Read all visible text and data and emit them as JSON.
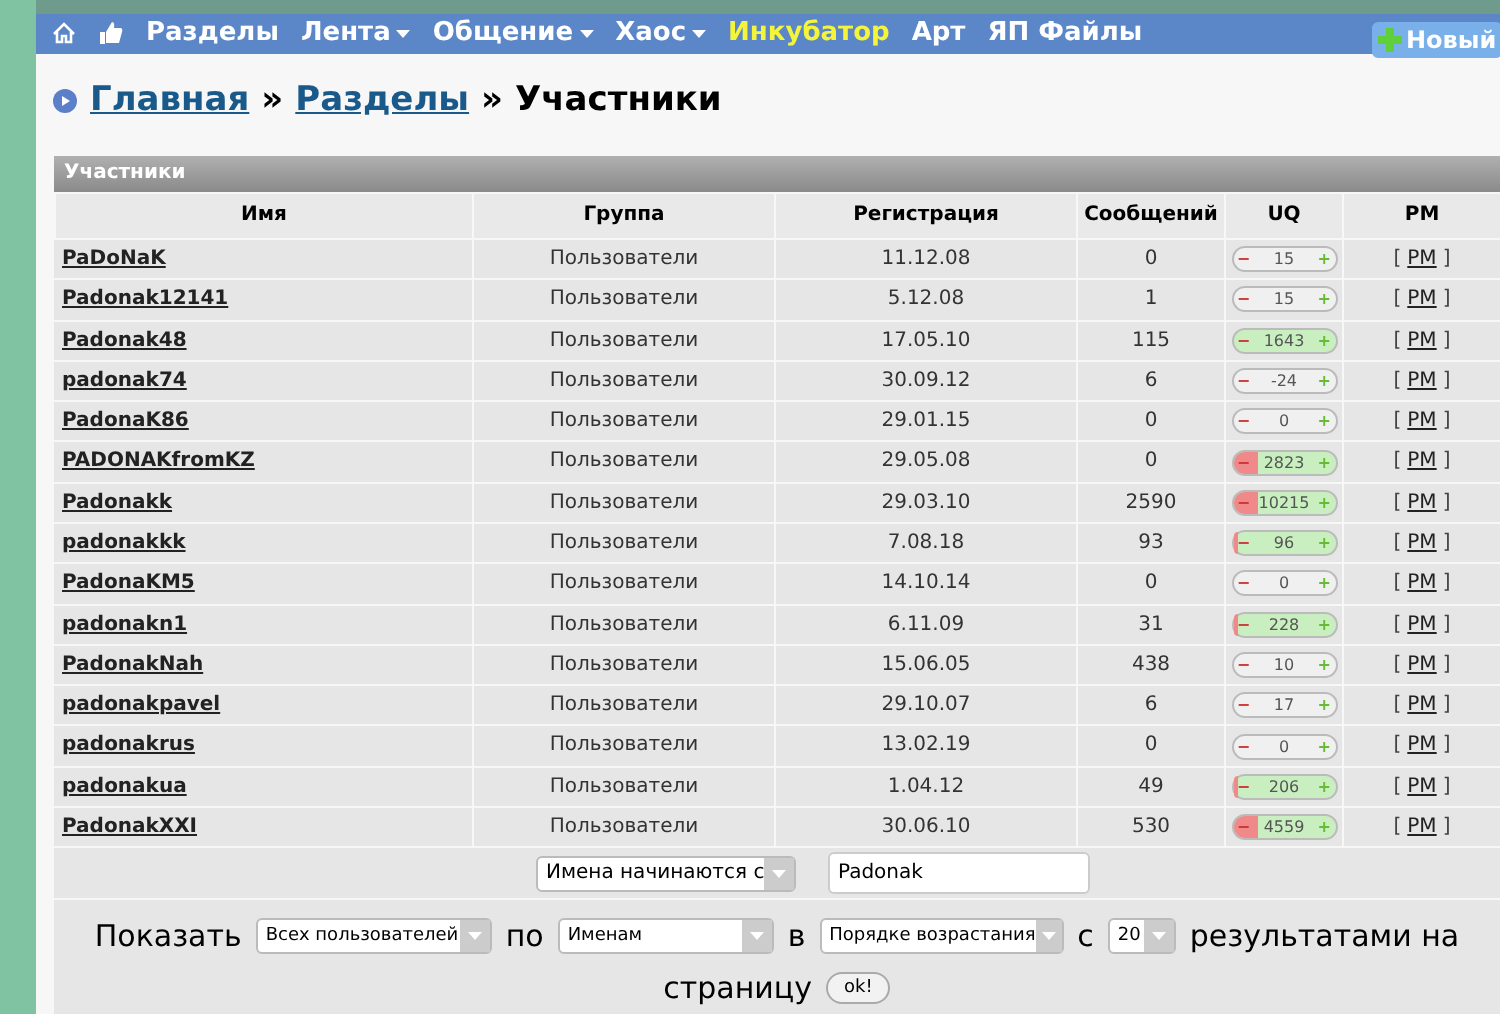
{
  "nav": {
    "items": [
      {
        "kind": "home"
      },
      {
        "kind": "like"
      },
      {
        "kind": "link",
        "label": "Разделы",
        "dropdown": false,
        "highlighted": false
      },
      {
        "kind": "link",
        "label": "Лента",
        "dropdown": true,
        "highlighted": false
      },
      {
        "kind": "link",
        "label": "Общение",
        "dropdown": true,
        "highlighted": false
      },
      {
        "kind": "link",
        "label": "Хаос",
        "dropdown": true,
        "highlighted": false
      },
      {
        "kind": "link",
        "label": "Инкубатор",
        "dropdown": false,
        "highlighted": true
      },
      {
        "kind": "link",
        "label": "Арт",
        "dropdown": false,
        "highlighted": false
      },
      {
        "kind": "link",
        "label": "ЯП Файлы",
        "dropdown": false,
        "highlighted": false
      }
    ],
    "new_button": "Новый"
  },
  "breadcrumb": {
    "links": [
      "Главная",
      "Разделы"
    ],
    "separator": "»",
    "current": "Участники"
  },
  "table": {
    "title": "Участники",
    "columns": [
      "Имя",
      "Группа",
      "Регистрация",
      "Сообщений",
      "UQ",
      "PM"
    ],
    "rows": [
      {
        "name": "PaDoNaK",
        "group": "Пользователи",
        "registered": "11.12.08",
        "posts": "0",
        "uq": {
          "minus": "−",
          "value": "15",
          "plus": "+",
          "kind": "neutral"
        },
        "pm": {
          "open": "[",
          "link": "PM",
          "close": "]"
        }
      },
      {
        "name": "Padonak12141",
        "group": "Пользователи",
        "registered": "5.12.08",
        "posts": "1",
        "uq": {
          "minus": "−",
          "value": "15",
          "plus": "+",
          "kind": "neutral"
        },
        "pm": {
          "open": "[",
          "link": "PM",
          "close": "]"
        }
      },
      {
        "name": "Padonak48",
        "group": "Пользователи",
        "registered": "17.05.10",
        "posts": "115",
        "uq": {
          "minus": "−",
          "value": "1643",
          "plus": "+",
          "kind": "positive"
        },
        "pm": {
          "open": "[",
          "link": "PM",
          "close": "]"
        }
      },
      {
        "name": "padonak74",
        "group": "Пользователи",
        "registered": "30.09.12",
        "posts": "6",
        "uq": {
          "minus": "−",
          "value": "-24",
          "plus": "+",
          "kind": "neutral"
        },
        "pm": {
          "open": "[",
          "link": "PM",
          "close": "]"
        }
      },
      {
        "name": "PadonaK86",
        "group": "Пользователи",
        "registered": "29.01.15",
        "posts": "0",
        "uq": {
          "minus": "−",
          "value": "0",
          "plus": "+",
          "kind": "neutral"
        },
        "pm": {
          "open": "[",
          "link": "PM",
          "close": "]"
        }
      },
      {
        "name": "PADONAKfromKZ",
        "group": "Пользователи",
        "registered": "29.05.08",
        "posts": "0",
        "uq": {
          "minus": "−",
          "value": "2823",
          "plus": "+",
          "kind": "mixed"
        },
        "pm": {
          "open": "[",
          "link": "PM",
          "close": "]"
        }
      },
      {
        "name": "Padonakk",
        "group": "Пользователи",
        "registered": "29.03.10",
        "posts": "2590",
        "uq": {
          "minus": "−",
          "value": "10215",
          "plus": "+",
          "kind": "mixed"
        },
        "pm": {
          "open": "[",
          "link": "PM",
          "close": "]"
        }
      },
      {
        "name": "padonakkk",
        "group": "Пользователи",
        "registered": "7.08.18",
        "posts": "93",
        "uq": {
          "minus": "−",
          "value": "96",
          "plus": "+",
          "kind": "slight"
        },
        "pm": {
          "open": "[",
          "link": "PM",
          "close": "]"
        }
      },
      {
        "name": "PadonaKM5",
        "group": "Пользователи",
        "registered": "14.10.14",
        "posts": "0",
        "uq": {
          "minus": "−",
          "value": "0",
          "plus": "+",
          "kind": "neutral"
        },
        "pm": {
          "open": "[",
          "link": "PM",
          "close": "]"
        }
      },
      {
        "name": "padonakn1",
        "group": "Пользователи",
        "registered": "6.11.09",
        "posts": "31",
        "uq": {
          "minus": "−",
          "value": "228",
          "plus": "+",
          "kind": "slight"
        },
        "pm": {
          "open": "[",
          "link": "PM",
          "close": "]"
        }
      },
      {
        "name": "PadonakNah",
        "group": "Пользователи",
        "registered": "15.06.05",
        "posts": "438",
        "uq": {
          "minus": "−",
          "value": "10",
          "plus": "+",
          "kind": "neutral"
        },
        "pm": {
          "open": "[",
          "link": "PM",
          "close": "]"
        }
      },
      {
        "name": "padonakpavel",
        "group": "Пользователи",
        "registered": "29.10.07",
        "posts": "6",
        "uq": {
          "minus": "−",
          "value": "17",
          "plus": "+",
          "kind": "neutral"
        },
        "pm": {
          "open": "[",
          "link": "PM",
          "close": "]"
        }
      },
      {
        "name": "padonakrus",
        "group": "Пользователи",
        "registered": "13.02.19",
        "posts": "0",
        "uq": {
          "minus": "−",
          "value": "0",
          "plus": "+",
          "kind": "neutral"
        },
        "pm": {
          "open": "[",
          "link": "PM",
          "close": "]"
        }
      },
      {
        "name": "padonakua",
        "group": "Пользователи",
        "registered": "1.04.12",
        "posts": "49",
        "uq": {
          "minus": "−",
          "value": "206",
          "plus": "+",
          "kind": "slight"
        },
        "pm": {
          "open": "[",
          "link": "PM",
          "close": "]"
        }
      },
      {
        "name": "PadonakXXI",
        "group": "Пользователи",
        "registered": "30.06.10",
        "posts": "530",
        "uq": {
          "minus": "−",
          "value": "4559",
          "plus": "+",
          "kind": "mixed"
        },
        "pm": {
          "open": "[",
          "link": "PM",
          "close": "]"
        }
      }
    ]
  },
  "filter": {
    "mode_select": "Имена начинаются с",
    "value": "Padonak"
  },
  "display": [
    {
      "kind": "text",
      "text": "Показать"
    },
    {
      "kind": "select",
      "value": "Всех пользователей"
    },
    {
      "kind": "text",
      "text": "по"
    },
    {
      "kind": "select",
      "value": "Именам"
    },
    {
      "kind": "text",
      "text": "в"
    },
    {
      "kind": "select",
      "value": "Порядке возрастания"
    },
    {
      "kind": "text",
      "text": "с"
    },
    {
      "kind": "select",
      "value": "20"
    },
    {
      "kind": "text",
      "text": "результатами на"
    },
    {
      "kind": "break"
    },
    {
      "kind": "text",
      "text": "страницу"
    },
    {
      "kind": "button",
      "text": "ok!"
    }
  ]
}
